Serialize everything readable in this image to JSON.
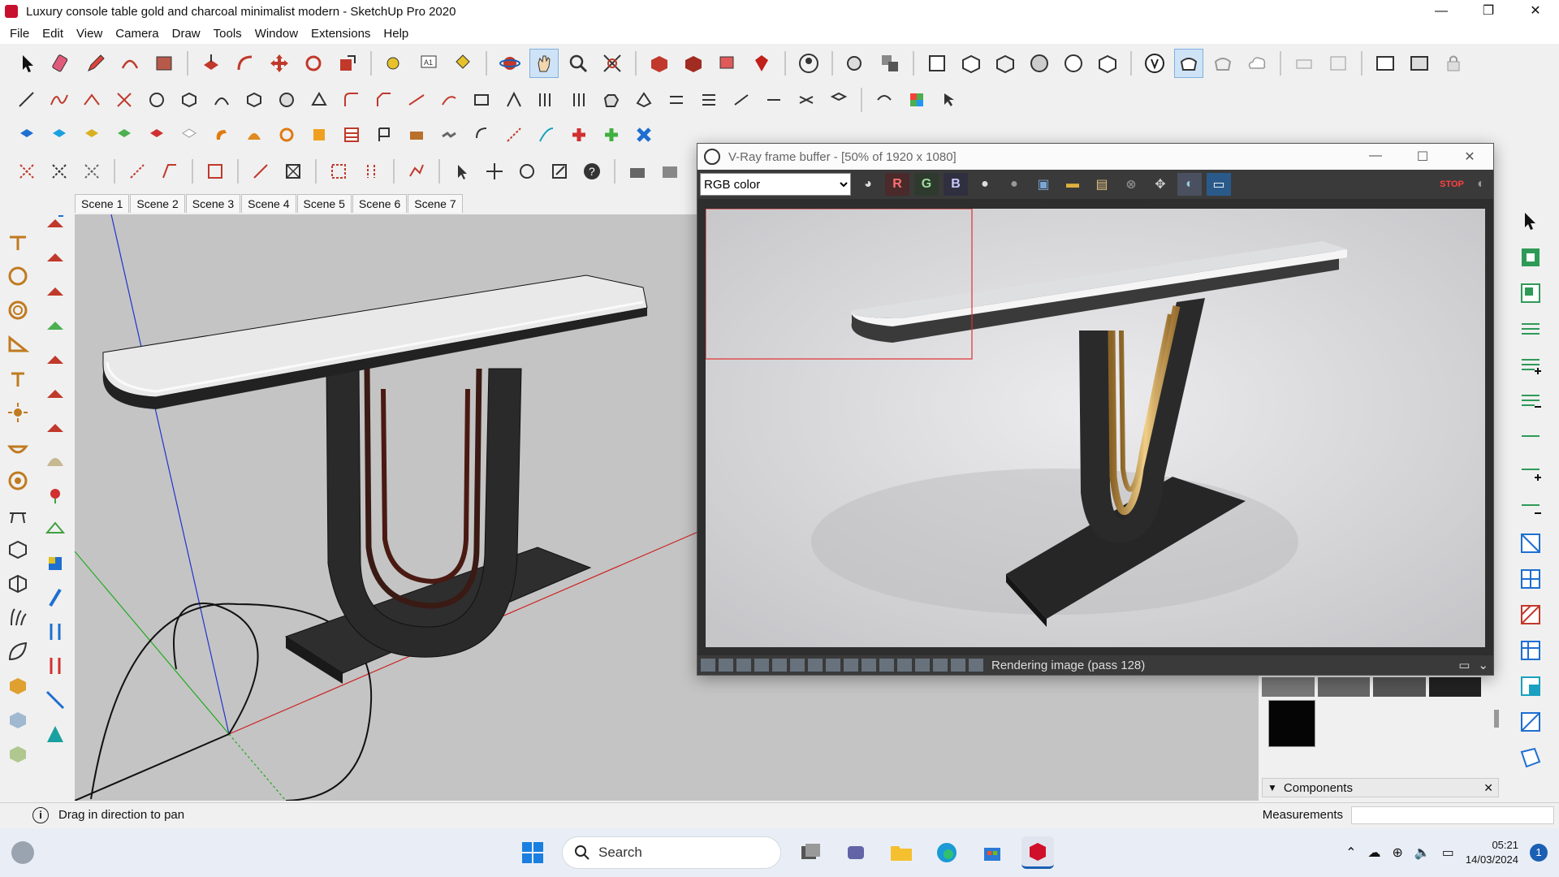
{
  "window": {
    "title": "Luxury console table gold and charcoal minimalist modern - SketchUp Pro 2020",
    "minimize": "—",
    "restore": "❐",
    "close": "✕"
  },
  "menu": [
    "File",
    "Edit",
    "View",
    "Camera",
    "Draw",
    "Tools",
    "Window",
    "Extensions",
    "Help"
  ],
  "scenes": [
    "Scene 1",
    "Scene 2",
    "Scene 3",
    "Scene 4",
    "Scene 5",
    "Scene 6",
    "Scene 7"
  ],
  "vray": {
    "title": "V-Ray frame buffer - [50% of 1920 x 1080]",
    "channel": "RGB color",
    "r_label": "R",
    "g_label": "G",
    "b_label": "B",
    "status": "Rendering image (pass 128)",
    "stop_label": "STOP"
  },
  "status": {
    "hint": "Drag in direction to pan",
    "measurements_label": "Measurements"
  },
  "panels": {
    "components_label": "Components"
  },
  "taskbar": {
    "search_placeholder": "Search",
    "time": "05:21",
    "date": "14/03/2024",
    "notification_count": "1"
  },
  "colors": {
    "viewport_bg": "#c4c4c4",
    "render_bg": "#d7d7d9",
    "accent": "#1a5fb4",
    "charcoal": "#2b2b2b",
    "gold": "#c9a15a",
    "selection": "#e03030"
  }
}
